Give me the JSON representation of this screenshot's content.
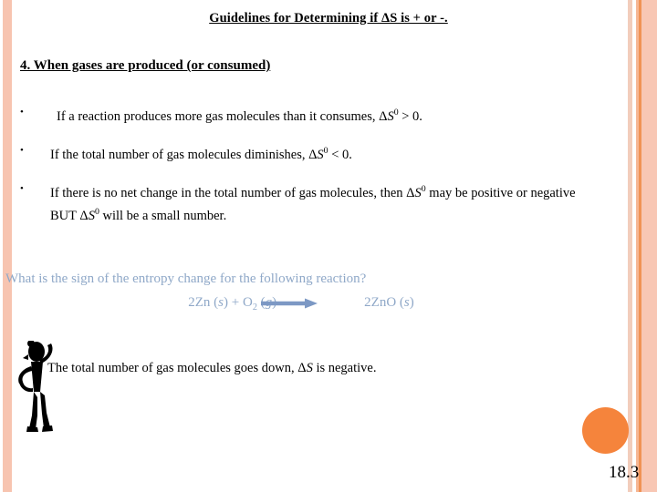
{
  "slide": {
    "title": "Guidelines for Determining if ΔS is  + or -.",
    "section_heading": "4.  When gases are produced (or consumed)",
    "page_number": "18.3"
  },
  "bullets": [
    {
      "marker": "•",
      "text_before": "If a reaction produces more gas molecules than it consumes, Δ",
      "symbol": "S",
      "symbol_sup": "0",
      "text_after": " > 0."
    },
    {
      "marker": "•",
      "text_before": "If the total number of gas molecules diminishes, Δ",
      "symbol": "S",
      "symbol_sup": "0",
      "text_after": " < 0."
    },
    {
      "marker": "•",
      "text_before": "If there is no net change in the total number of gas molecules, then Δ",
      "symbol": "S",
      "symbol_sup": "0",
      "text_mid": " may be positive or negative BUT Δ",
      "symbol2": "S",
      "symbol2_sup": "0",
      "text_after": " will be a small number."
    }
  ],
  "question": {
    "prompt": "What is the sign of the entropy change for the following reaction?",
    "equation": {
      "reactant_coeff_1": "2Zn (",
      "reactant_state_1": "s",
      "plus": ") + O",
      "oxygen_sub": "2",
      "gas_open": " (",
      "gas_state": "g",
      "gas_close": ")",
      "product": "2ZnO (",
      "product_state": "s",
      "product_close": ")",
      "arrow_icon": "right-arrow-icon"
    },
    "text_color": "#8FA8C8"
  },
  "answer": {
    "text_before": "The total number of gas molecules goes down, Δ",
    "symbol": "S",
    "text_after": " is negative."
  },
  "decor": {
    "figure_icon": "stick-figure-thinking-icon",
    "accent_dot_color": "#F5843C",
    "left_border_color": "#F7C4B0",
    "right_border_color": "#F8C7B4"
  }
}
